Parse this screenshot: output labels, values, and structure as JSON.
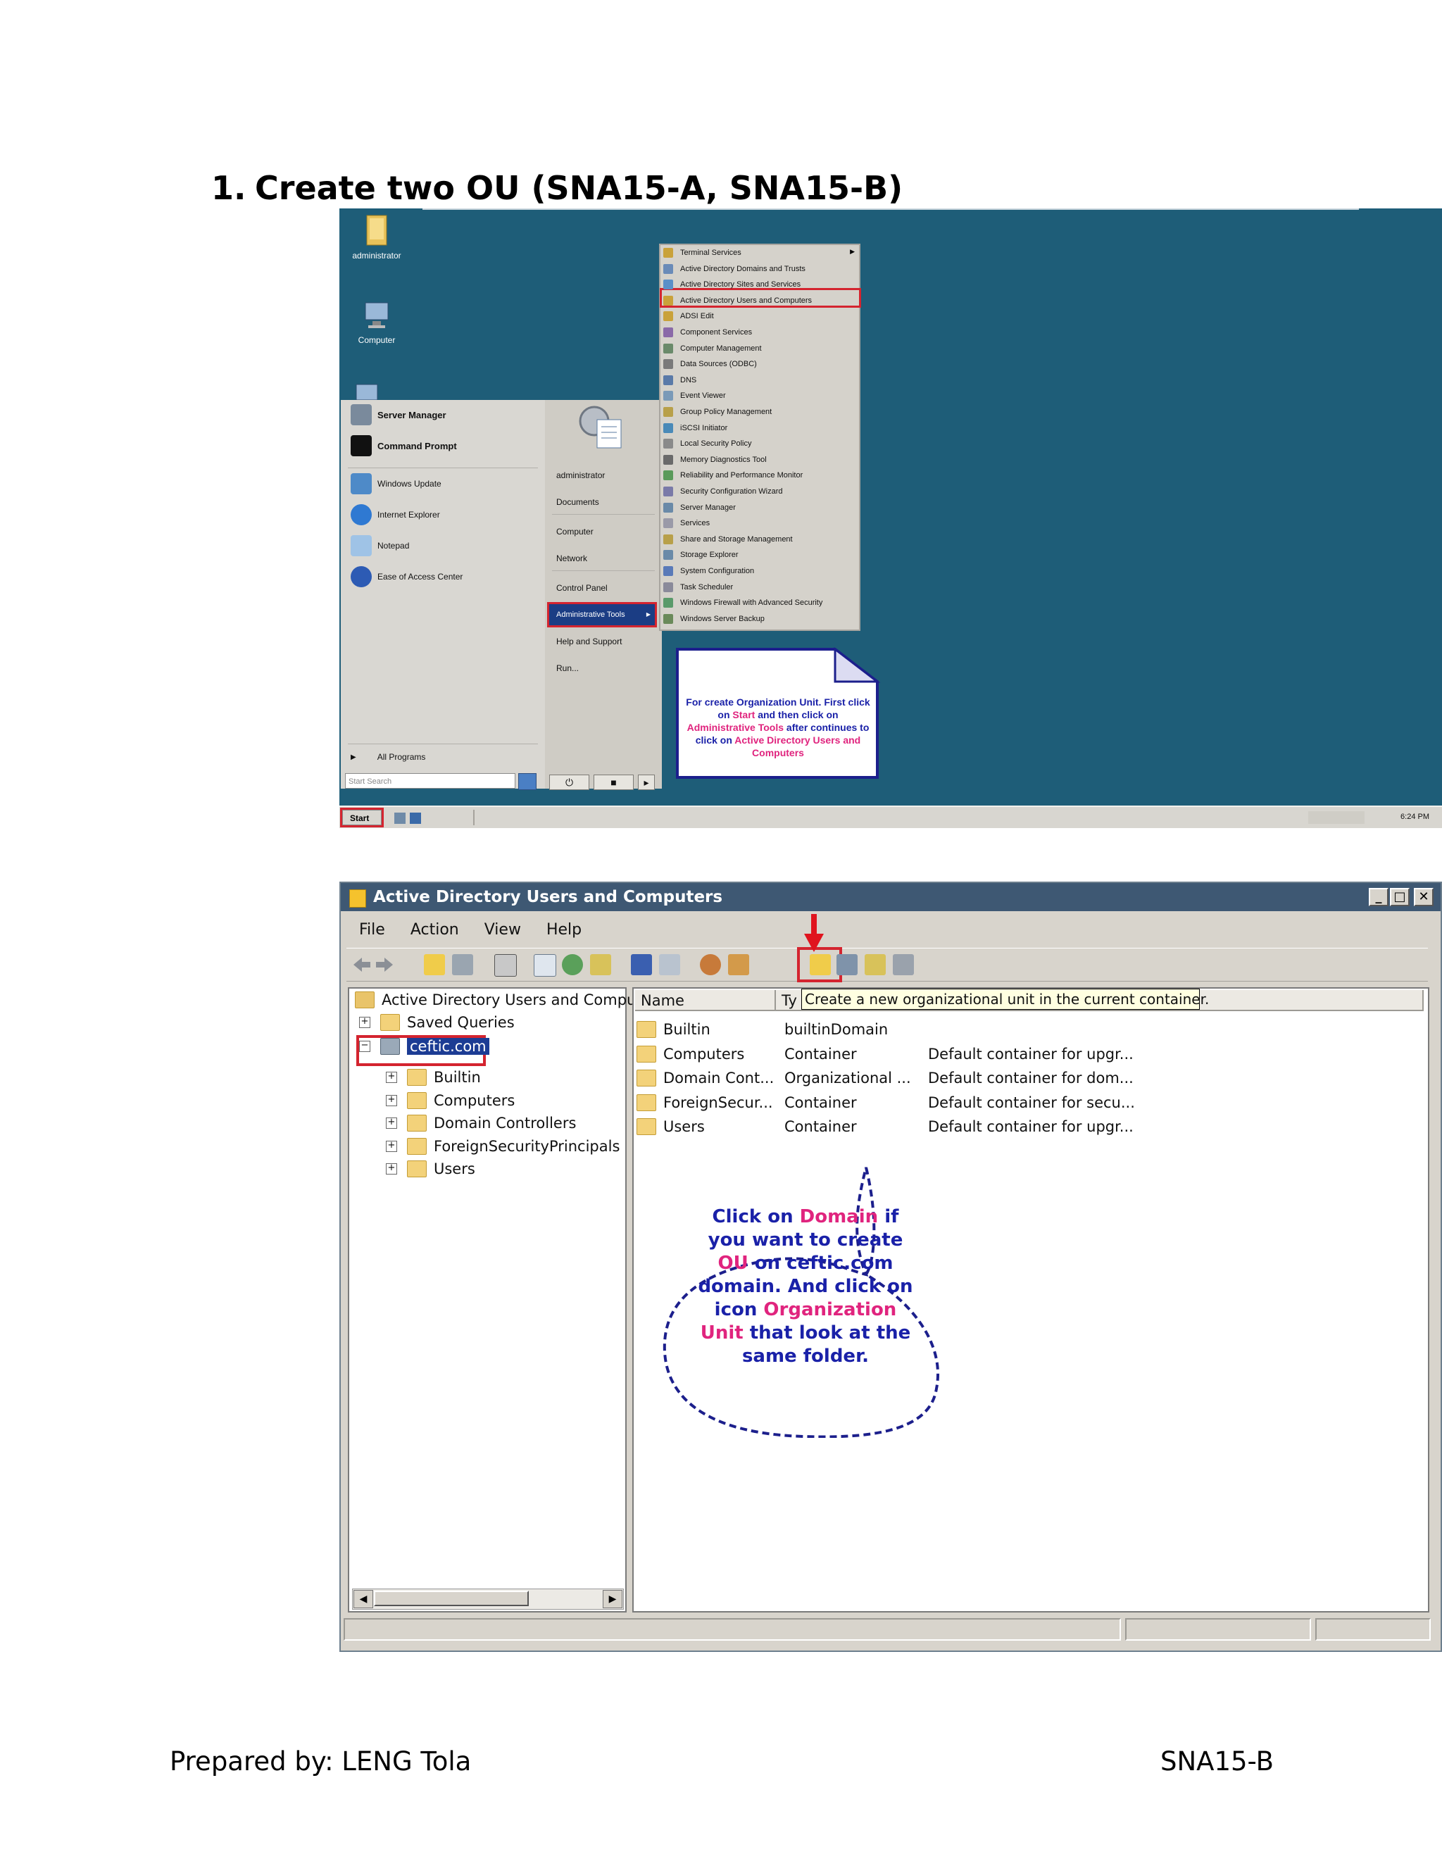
{
  "heading": {
    "number": "1.",
    "text": "Create two OU (SNA15-A, SNA15-B)"
  },
  "desktop": {
    "icons": [
      "administrator",
      "Computer"
    ],
    "start_menu": {
      "pinned": [
        "Server Manager",
        "Command Prompt"
      ],
      "recent": [
        "Windows Update",
        "Internet Explorer",
        "Notepad",
        "Ease of Access Center"
      ],
      "all_programs": "All Programs",
      "search_placeholder": "Start Search",
      "right_links": [
        "administrator",
        "Documents",
        "Computer",
        "Network",
        "Control Panel",
        "Administrative Tools",
        "Help and Support",
        "Run..."
      ]
    },
    "admin_tools_submenu": [
      "Terminal Services",
      "Active Directory Domains and Trusts",
      "Active Directory Sites and Services",
      "Active Directory Users and Computers",
      "ADSI Edit",
      "Component Services",
      "Computer Management",
      "Data Sources (ODBC)",
      "DNS",
      "Event Viewer",
      "Group Policy Management",
      "iSCSI Initiator",
      "Local Security Policy",
      "Memory Diagnostics Tool",
      "Reliability and Performance Monitor",
      "Security Configuration Wizard",
      "Server Manager",
      "Services",
      "Share and Storage Management",
      "Storage Explorer",
      "System Configuration",
      "Task Scheduler",
      "Windows Firewall with Advanced Security",
      "Windows Server Backup"
    ],
    "note": {
      "p1": "For create Organization Unit. First click on ",
      "k1": "Start",
      "p2": " and then click on ",
      "k2": "Administrative Tools",
      "p3": " after continues to click on ",
      "k3": "Active Directory Users and Computers"
    },
    "taskbar": {
      "start": "Start",
      "clock": "6:24 PM"
    }
  },
  "aduc": {
    "title": "Active Directory Users and Computers",
    "menu": [
      "File",
      "Action",
      "View",
      "Help"
    ],
    "tree": {
      "root": "Active Directory Users and Comput",
      "saved_queries": "Saved Queries",
      "domain": "ceftic.com",
      "children": [
        "Builtin",
        "Computers",
        "Domain Controllers",
        "ForeignSecurityPrincipals",
        "Users"
      ]
    },
    "columns": {
      "name": "Name",
      "type": "Ty"
    },
    "tooltip": "Create a new organizational unit in the current container.",
    "rows": [
      {
        "name": "Builtin",
        "type": "builtinDomain",
        "desc": ""
      },
      {
        "name": "Computers",
        "type": "Container",
        "desc": "Default container for upgr..."
      },
      {
        "name": "Domain Cont...",
        "type": "Organizational ...",
        "desc": "Default container for dom..."
      },
      {
        "name": "ForeignSecur...",
        "type": "Container",
        "desc": "Default container for secu..."
      },
      {
        "name": "Users",
        "type": "Container",
        "desc": "Default container for upgr..."
      }
    ],
    "bubble": {
      "a": "Click on ",
      "k1": "Domain",
      "b": " if you want to create ",
      "k2": "OU",
      "c": " on ceftic.com domain. And click on icon ",
      "k3": "Organization Unit",
      "d": " that look at the same folder."
    }
  },
  "footer": {
    "left": "Prepared by: LENG Tola",
    "right": "SNA15-B"
  }
}
